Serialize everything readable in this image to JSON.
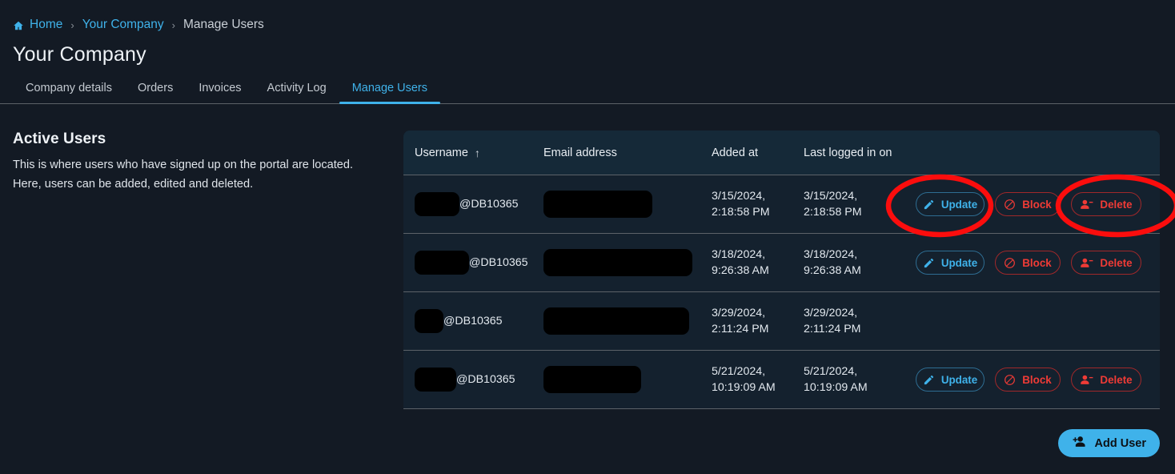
{
  "breadcrumb": {
    "home_label": "Home",
    "company_label": "Your Company",
    "current_label": "Manage Users",
    "separator": "›",
    "home_icon": "home-icon",
    "link_color": "#3fb2ea"
  },
  "header": {
    "title": "Your Company"
  },
  "tabs": [
    {
      "label": "Company details",
      "active": false
    },
    {
      "label": "Orders",
      "active": false
    },
    {
      "label": "Invoices",
      "active": false
    },
    {
      "label": "Activity Log",
      "active": false
    },
    {
      "label": "Manage Users",
      "active": true
    }
  ],
  "left_panel": {
    "heading": "Active Users",
    "description": "This is where users who have signed up on the portal are located. Here, users can be added, edited and deleted."
  },
  "table": {
    "columns": [
      {
        "label": "Username",
        "sort": "ascending",
        "sort_icon": "arrow-up-icon"
      },
      {
        "label": "Email address"
      },
      {
        "label": "Added at"
      },
      {
        "label": "Last logged in on"
      },
      {
        "label": ""
      }
    ],
    "rows": [
      {
        "username_suffix": "@DB10365",
        "username_redacted_width": 56,
        "email_redacted_width": 136,
        "added_at_date": "3/15/2024,",
        "added_at_time": "2:18:58 PM",
        "last_logged_date": "3/15/2024,",
        "last_logged_time": "2:18:58 PM",
        "has_actions": true
      },
      {
        "username_suffix": "@DB10365",
        "username_redacted_width": 68,
        "email_redacted_width": 186,
        "added_at_date": "3/18/2024,",
        "added_at_time": "9:26:38 AM",
        "last_logged_date": "3/18/2024,",
        "last_logged_time": "9:26:38 AM",
        "has_actions": true
      },
      {
        "username_suffix": "@DB10365",
        "username_redacted_width": 36,
        "email_redacted_width": 182,
        "added_at_date": "3/29/2024,",
        "added_at_time": "2:11:24 PM",
        "last_logged_date": "3/29/2024,",
        "last_logged_time": "2:11:24 PM",
        "has_actions": false
      },
      {
        "username_suffix": "@DB10365",
        "username_redacted_width": 52,
        "email_redacted_width": 122,
        "added_at_date": "5/21/2024,",
        "added_at_time": "10:19:09 AM",
        "last_logged_date": "5/21/2024,",
        "last_logged_time": "10:19:09 AM",
        "has_actions": true
      }
    ]
  },
  "actions": {
    "update_label": "Update",
    "update_icon": "pencil-icon",
    "update_color": "#3fb2ea",
    "block_label": "Block",
    "block_icon": "ban-icon",
    "block_color": "#ef3b36",
    "delete_label": "Delete",
    "delete_icon": "user-minus-icon",
    "delete_color": "#ef3b36"
  },
  "add_user": {
    "label": "Add User",
    "icon": "user-plus-icon",
    "color": "#3fb2ea"
  },
  "annotations": {
    "color": "#fb0d0d",
    "items": [
      {
        "name": "update-button-highlight",
        "shape": "ellipse"
      },
      {
        "name": "delete-button-highlight",
        "shape": "ellipse"
      }
    ]
  }
}
